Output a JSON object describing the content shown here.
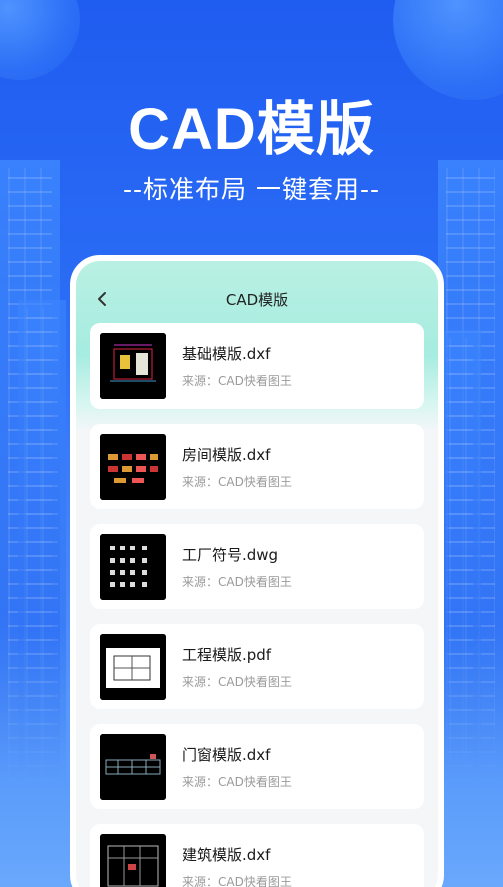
{
  "hero": {
    "title": "CAD模版",
    "subtitle": "--标准布局 一键套用--"
  },
  "screen": {
    "title": "CAD模版",
    "back_icon": "chevron-left-icon"
  },
  "items": [
    {
      "name": "基础模版.dxf",
      "source": "来源：CAD快看图王"
    },
    {
      "name": "房间模版.dxf",
      "source": "来源：CAD快看图王"
    },
    {
      "name": "工厂符号.dwg",
      "source": "来源：CAD快看图王"
    },
    {
      "name": "工程模版.pdf",
      "source": "来源：CAD快看图王"
    },
    {
      "name": "门窗模版.dxf",
      "source": "来源：CAD快看图王"
    },
    {
      "name": "建筑模版.dxf",
      "source": "来源：CAD快看图王"
    }
  ],
  "colors": {
    "background": "#2b6df5",
    "header_gradient": "#a6ece0",
    "card": "#ffffff"
  }
}
